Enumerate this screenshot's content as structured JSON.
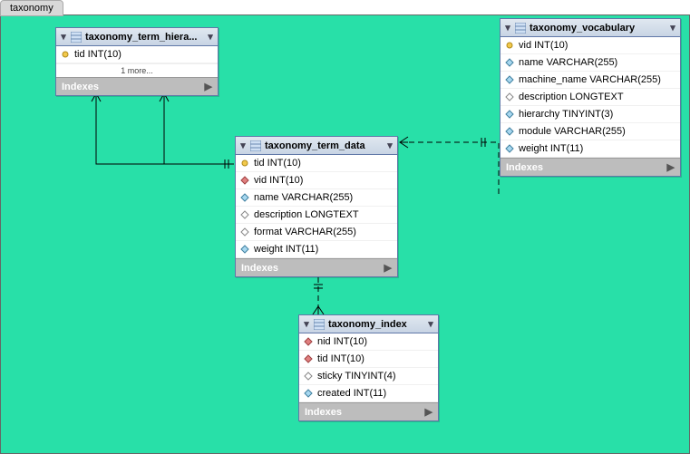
{
  "tab_label": "taxonomy",
  "indexes_label": "Indexes",
  "more_label": "1 more...",
  "tables": {
    "hierarchy": {
      "title": "taxonomy_term_hiera...",
      "cols": {
        "tid": "tid INT(10)"
      }
    },
    "term_data": {
      "title": "taxonomy_term_data",
      "cols": {
        "tid": "tid INT(10)",
        "vid": "vid INT(10)",
        "name": "name VARCHAR(255)",
        "description": "description LONGTEXT",
        "format": "format VARCHAR(255)",
        "weight": "weight INT(11)"
      }
    },
    "vocabulary": {
      "title": "taxonomy_vocabulary",
      "cols": {
        "vid": "vid INT(10)",
        "name": "name VARCHAR(255)",
        "machine_name": "machine_name VARCHAR(255)",
        "description": "description LONGTEXT",
        "hierarchy": "hierarchy TINYINT(3)",
        "module": "module VARCHAR(255)",
        "weight": "weight INT(11)"
      }
    },
    "index": {
      "title": "taxonomy_index",
      "cols": {
        "nid": "nid INT(10)",
        "tid": "tid INT(10)",
        "sticky": "sticky TINYINT(4)",
        "created": "created INT(11)"
      }
    }
  }
}
